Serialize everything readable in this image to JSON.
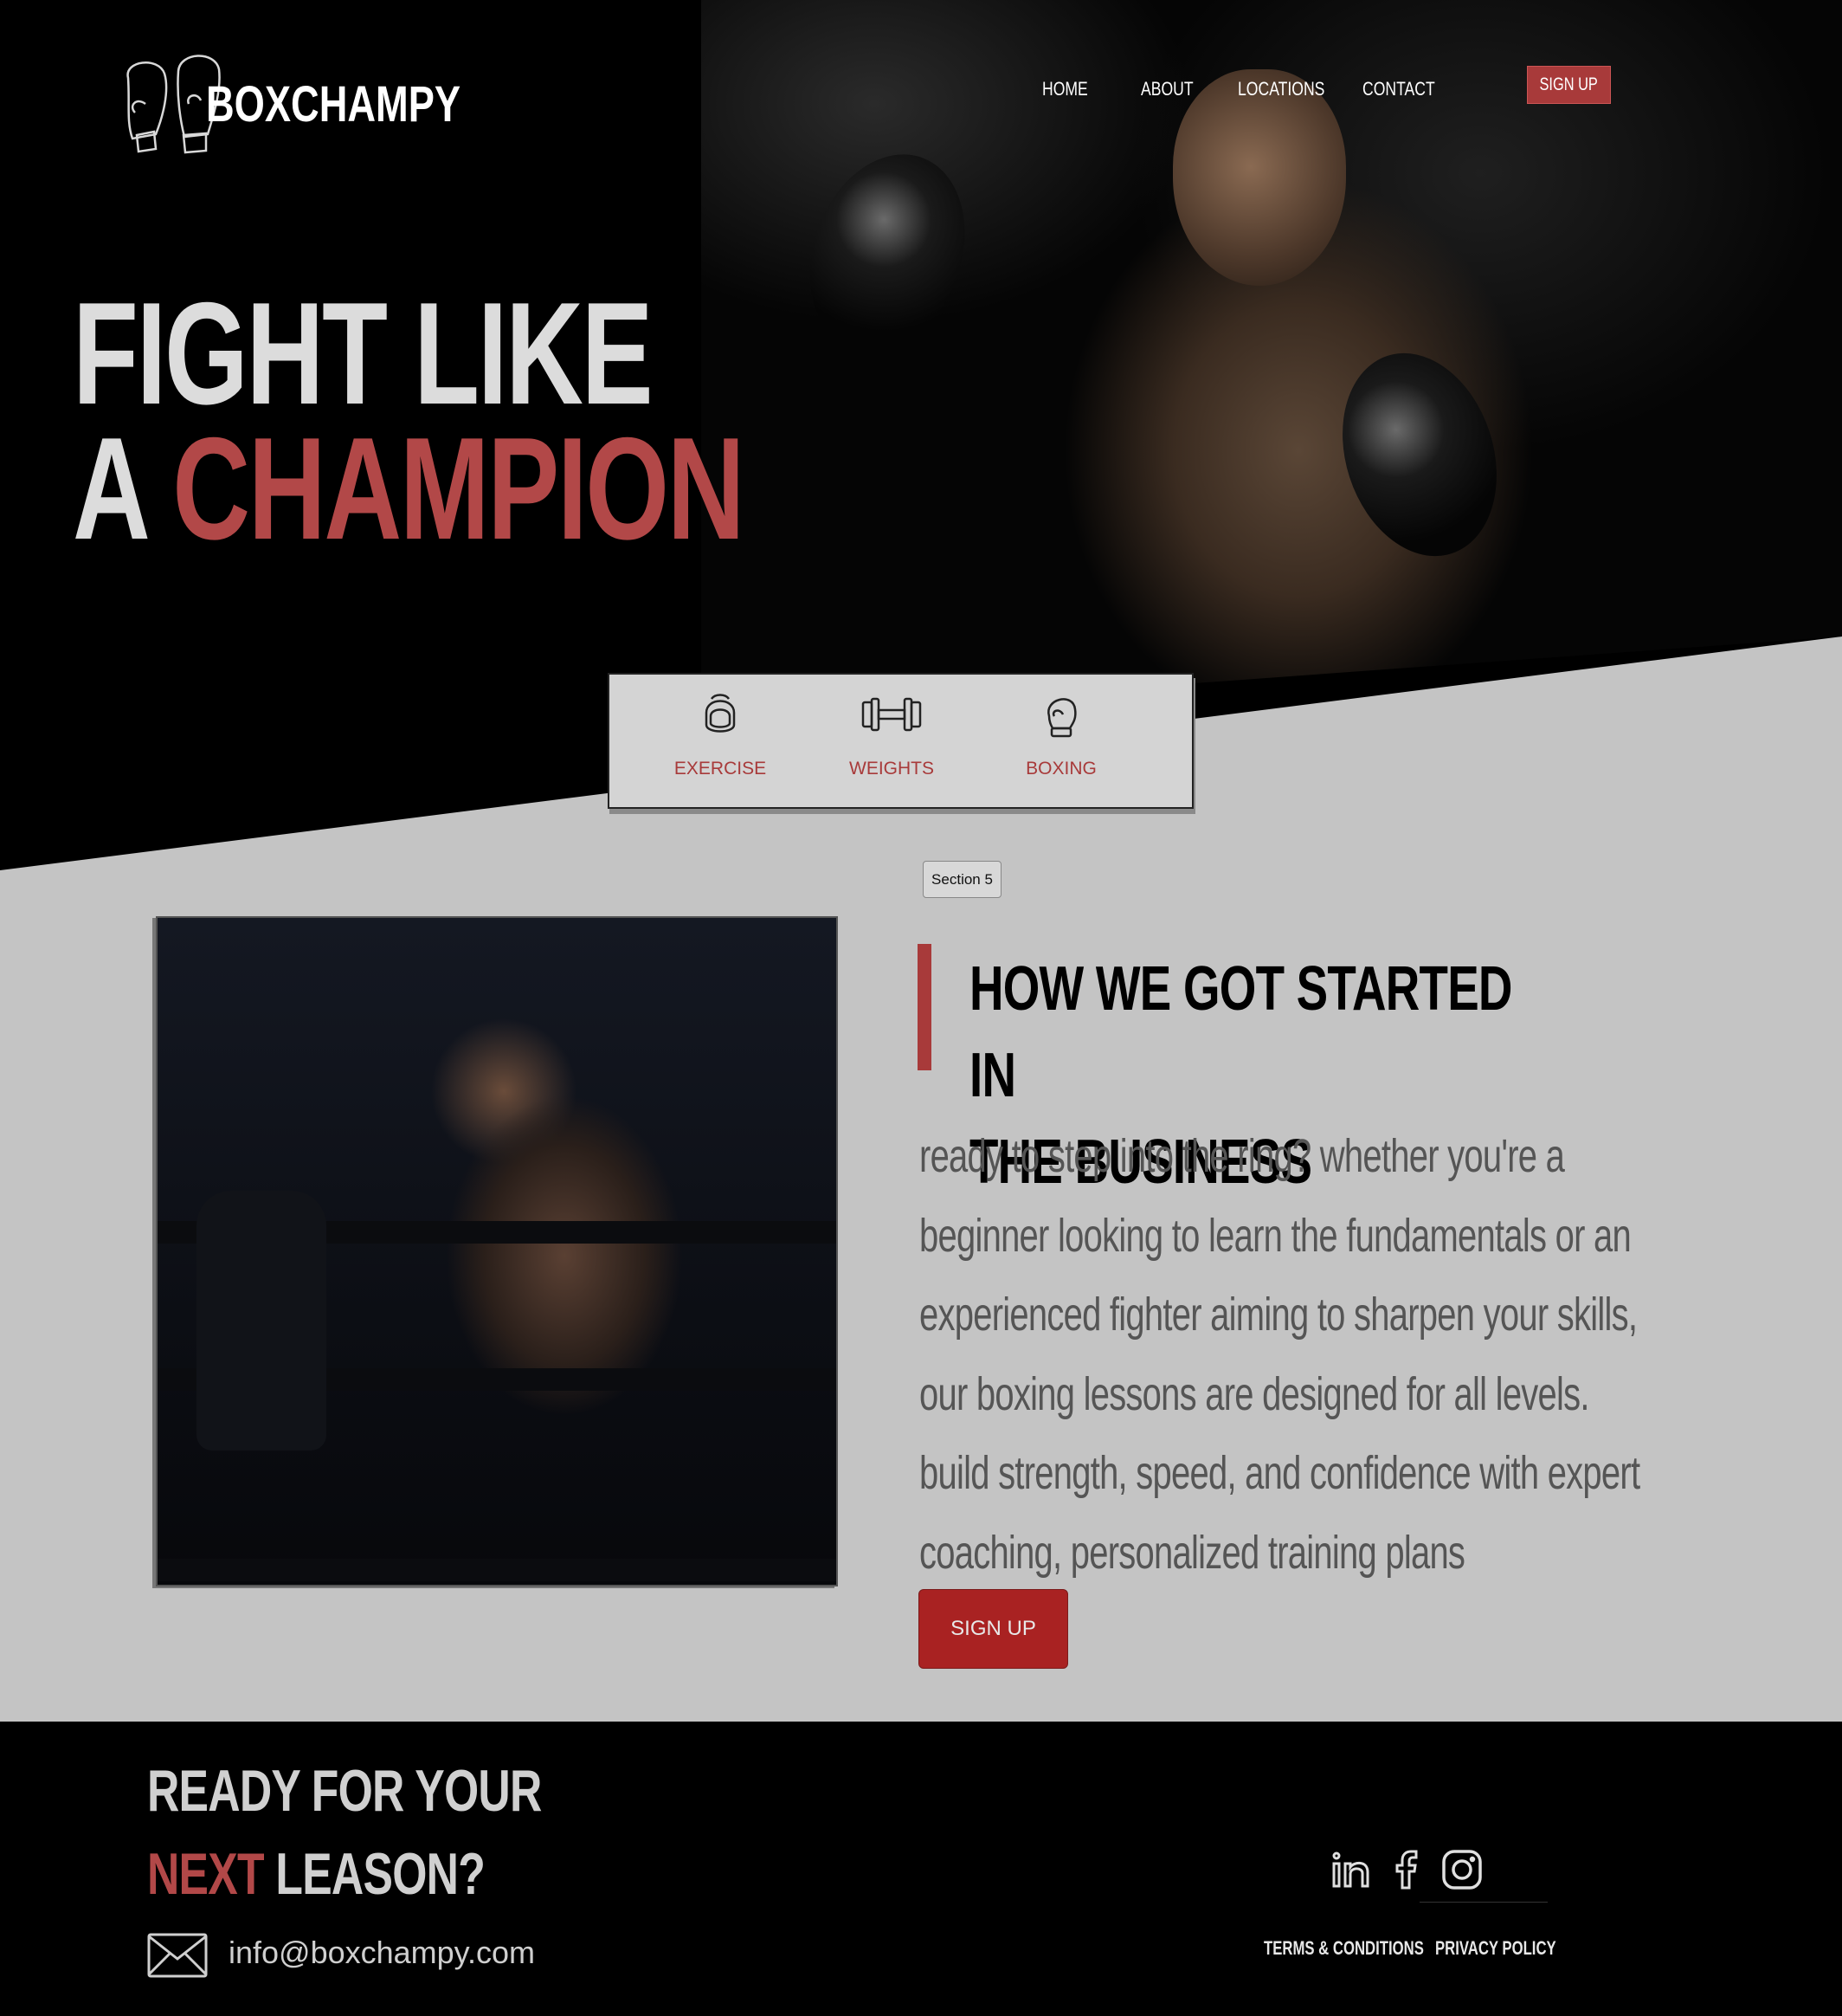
{
  "brand": {
    "name": "BOXCHAMPY",
    "accent": "#a83a3a"
  },
  "nav": {
    "items": [
      {
        "label": "HOME"
      },
      {
        "label": "ABOUT"
      },
      {
        "label": "LOCATIONS"
      },
      {
        "label": "CONTACT"
      }
    ],
    "signup_label": "SIGN UP"
  },
  "hero": {
    "line1": "FIGHT LIKE",
    "line2_prefix": "A",
    "line2_accent": "CHAMPION"
  },
  "features": [
    {
      "label": "EXERCISE",
      "icon": "headgear-icon"
    },
    {
      "label": "WEIGHTS",
      "icon": "dumbbell-icon"
    },
    {
      "label": "BOXING",
      "icon": "boxing-glove-icon"
    }
  ],
  "section_tag": "Section 5",
  "about": {
    "heading_line1": "HOW WE GOT STARTED IN",
    "heading_line2": "THE BUSINESS",
    "body_lines": [
      "ready to step into the ring? whether you're a",
      "beginner looking to learn the fundamentals or an",
      "experienced fighter aiming to sharpen your skills,",
      "our boxing lessons are designed for all levels.",
      "build strength, speed, and confidence with expert",
      "coaching, personalized training plans"
    ],
    "signup_label": "SIGN UP"
  },
  "footer": {
    "heading_line1": "READY FOR YOUR",
    "heading_line2_accent": "NEXT",
    "heading_line2_rest": "LEASON?",
    "email": "info@boxchampy.com",
    "socials": [
      "linkedin-icon",
      "facebook-icon",
      "instagram-icon"
    ],
    "terms_label": "TERMS & CONDITIONS",
    "privacy_label": "PRIVACY POLICY"
  }
}
